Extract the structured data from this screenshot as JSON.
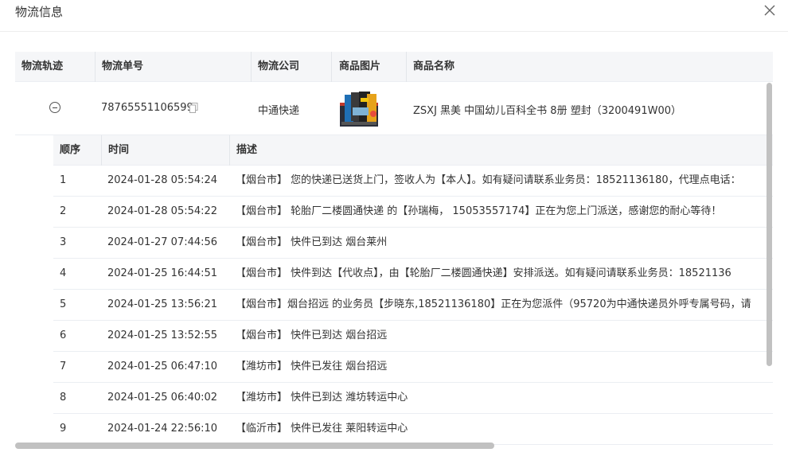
{
  "dialog": {
    "title": "物流信息",
    "close_icon": "close-icon"
  },
  "columns": {
    "track": "物流轨迹",
    "number": "物流单号",
    "company": "物流公司",
    "image": "商品图片",
    "name": "商品名称"
  },
  "shipment": {
    "number": "78765551106599",
    "company": "中通快递",
    "product_name": "ZSXJ 黑美 中国幼儿百科全书 8册 塑封（3200491W00）"
  },
  "track_columns": {
    "seq": "顺序",
    "time": "时间",
    "desc": "描述"
  },
  "track_rows": [
    {
      "seq": "1",
      "time": "2024-01-28 05:54:24",
      "desc": "【烟台市】 您的快递已送货上门，签收人为【本人】。如有疑问请联系业务员：18521136180，代理点电话："
    },
    {
      "seq": "2",
      "time": "2024-01-28 05:54:22",
      "desc": "【烟台市】 轮胎厂二楼圆通快递 的【孙瑞梅， 15053557174】正在为您上门派送，感谢您的耐心等待！"
    },
    {
      "seq": "3",
      "time": "2024-01-27 07:44:56",
      "desc": "【烟台市】 快件已到达 烟台莱州"
    },
    {
      "seq": "4",
      "time": "2024-01-25 16:44:51",
      "desc": "【烟台市】 快件到达【代收点】，由【轮胎厂二楼圆通快递】安排派送。如有疑问请联系业务员：18521136"
    },
    {
      "seq": "5",
      "time": "2024-01-25 13:56:21",
      "desc": "【烟台市】烟台招远 的业务员【步晓东,18521136180】正在为您派件（95720为中通快递员外呼专属号码，请"
    },
    {
      "seq": "6",
      "time": "2024-01-25 13:52:55",
      "desc": "【烟台市】 快件已到达 烟台招远"
    },
    {
      "seq": "7",
      "time": "2024-01-25 06:47:10",
      "desc": "【潍坊市】 快件已发往 烟台招远"
    },
    {
      "seq": "8",
      "time": "2024-01-25 06:40:02",
      "desc": "【潍坊市】 快件已到达 潍坊转运中心"
    },
    {
      "seq": "9",
      "time": "2024-01-24 22:56:10",
      "desc": "【临沂市】 快件已发往 莱阳转运中心"
    }
  ],
  "colors": {
    "header_bg": "#f5f6f8",
    "border": "#ebeef2",
    "scrollbar": "#c1c1c1"
  }
}
